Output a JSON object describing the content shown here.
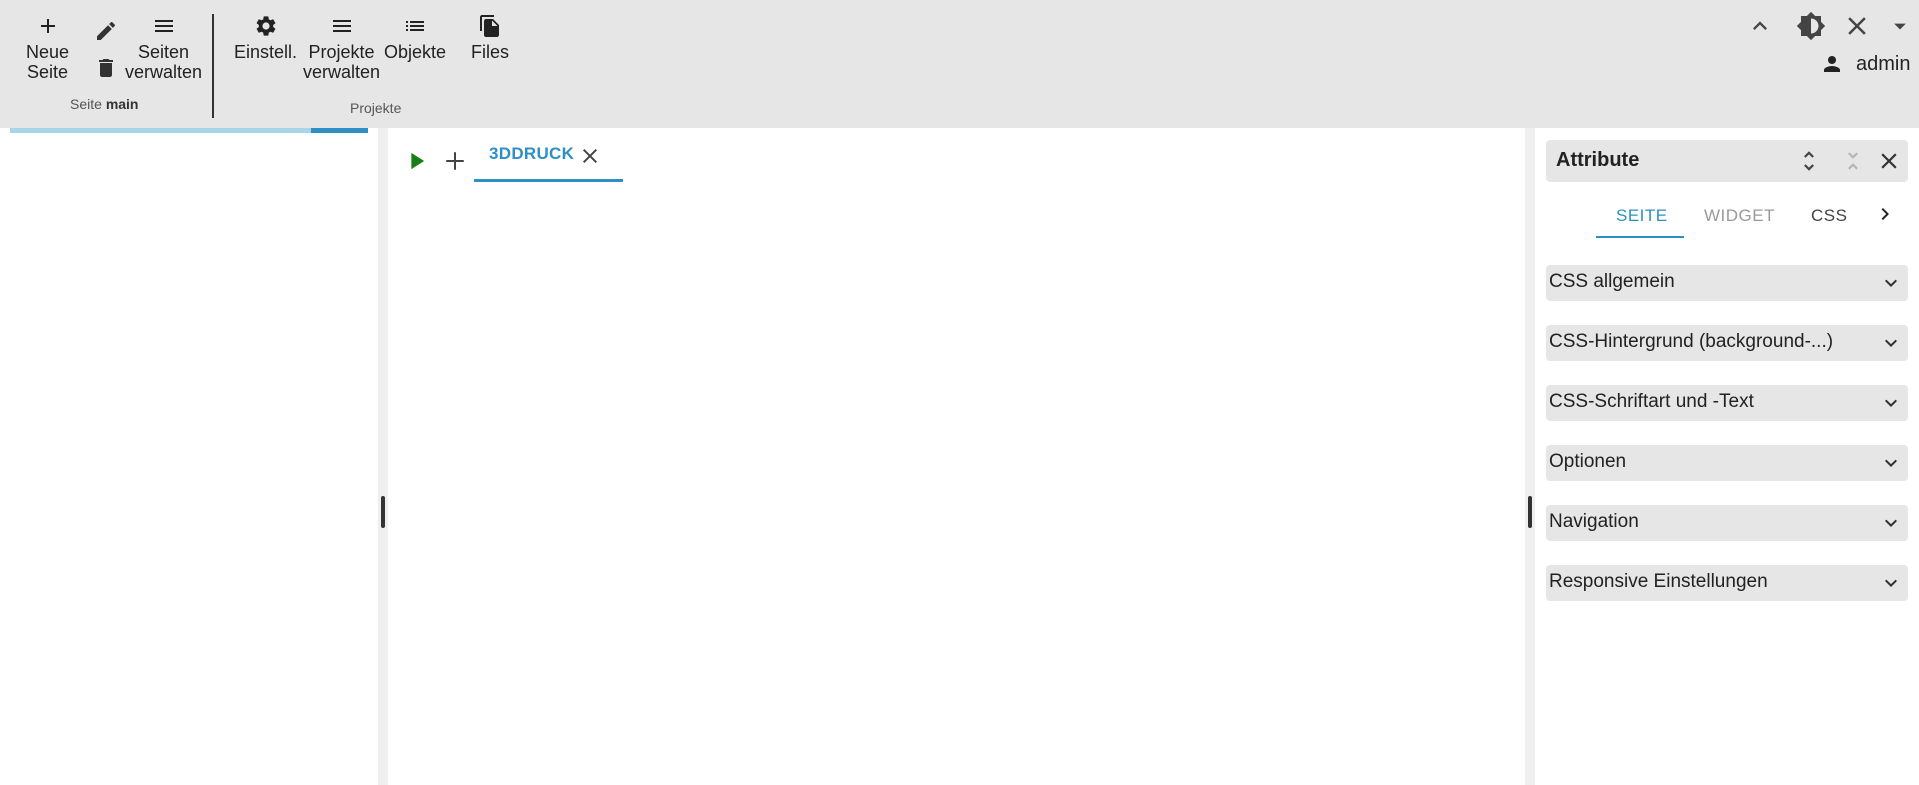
{
  "toolbar": {
    "new_page": "Neue\nSeite",
    "manage_pages": "Seiten\nverwalten",
    "page_group_prefix": "Seite",
    "page_group_name": "main",
    "settings": "Einstell.",
    "manage_projects": "Projekte\nverwalten",
    "objects": "Objekte",
    "files": "Files",
    "projects_group": "Projekte",
    "user_name": "admin"
  },
  "left_panel": {
    "progress_fraction": 0.84
  },
  "editor": {
    "tabs": [
      {
        "label": "3DDRUCK",
        "active": true
      }
    ]
  },
  "attributes": {
    "title": "Attribute",
    "tabs": [
      {
        "label": "SEITE",
        "state": "active"
      },
      {
        "label": "WIDGET",
        "state": "disabled"
      },
      {
        "label": "CSS",
        "state": "normal"
      }
    ],
    "sections": [
      "CSS allgemein",
      "CSS-Hintergrund (background-...)",
      "CSS-Schriftart und -Text",
      "Optionen",
      "Navigation",
      "Responsive Einstellungen"
    ]
  },
  "colors": {
    "accent": "#2e8fc5",
    "toolbar_bg": "#e6e6e6",
    "play": "#1a7e16",
    "progress_track": "#a8d6e8"
  },
  "icons": {
    "new_page": "plus-icon",
    "edit": "pencil-icon",
    "delete": "trash-icon",
    "manage_pages": "menu-icon",
    "settings": "gear-icon",
    "manage_projects": "menu-icon",
    "objects": "list-icon",
    "files": "files-icon",
    "collapse": "chevron-up-icon",
    "theme": "brightness-icon",
    "close": "close-icon",
    "dropdown": "triangle-down-icon",
    "user": "person-icon"
  }
}
